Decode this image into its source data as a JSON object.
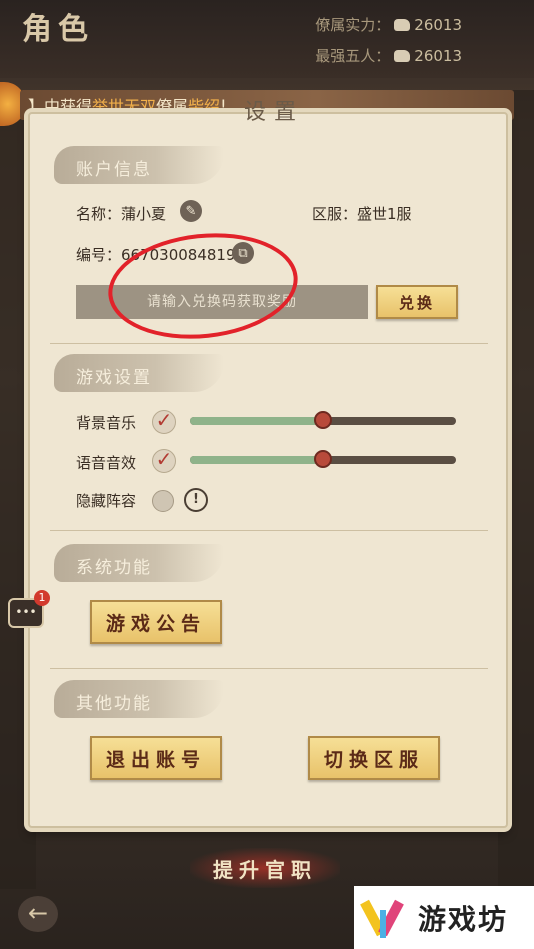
{
  "header": {
    "title": "角色",
    "stats": [
      {
        "label": "僚属实力：",
        "value": "26013"
      },
      {
        "label": "最强五人：",
        "value": "26013"
      }
    ]
  },
  "banner": {
    "prefix": "】中获得",
    "highlight1": "举世无双",
    "middle": "僚属",
    "highlight2": "柴绍",
    "suffix": "!"
  },
  "panel": {
    "title": "设置",
    "account": {
      "section": "账户信息",
      "name_label": "名称：蒲小夏",
      "server_label": "区服：盛世1服",
      "id_label": "编号：66703",
      "id_value": "0084819",
      "redeem_placeholder": "请输入兑换码获取奖励",
      "redeem_button": "兑换"
    },
    "game": {
      "section": "游戏设置",
      "bgm_label": "背景音乐",
      "voice_label": "语音音效",
      "hide_label": "隐藏阵容",
      "bgm_level": 0.5,
      "voice_level": 0.5
    },
    "system": {
      "section": "系统功能",
      "notice_button": "游戏公告"
    },
    "other": {
      "section": "其他功能",
      "logout_button": "退出账号",
      "switch_server_button": "切换区服"
    }
  },
  "chat_badge": "1",
  "bottom": {
    "promote": "提升官职"
  },
  "watermark": {
    "text": "游戏坊"
  }
}
